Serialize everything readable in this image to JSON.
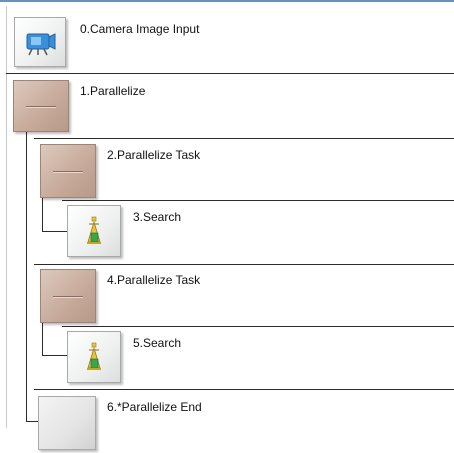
{
  "flow_items": [
    {
      "index": 0,
      "label": "0.Camera Image Input",
      "icon": "camera-icon"
    },
    {
      "index": 1,
      "label": "1.Parallelize",
      "icon": "parallelize-icon"
    },
    {
      "index": 2,
      "label": "2.Parallelize Task",
      "icon": "parallelize-task-icon"
    },
    {
      "index": 3,
      "label": "3.Search",
      "icon": "search-icon"
    },
    {
      "index": 4,
      "label": "4.Parallelize Task",
      "icon": "parallelize-task-icon"
    },
    {
      "index": 5,
      "label": "5.Search",
      "icon": "search-icon"
    },
    {
      "index": 6,
      "label": "6.*Parallelize End",
      "icon": "parallelize-end-icon"
    }
  ],
  "colors": {
    "parallelize_icon": "#c6a999",
    "separator": "#2b2b2b",
    "top_border": "#6e8fb8",
    "camera_blue": "#3b8fd9",
    "search_yellow": "#e9c43a",
    "search_green": "#3aa54a"
  }
}
